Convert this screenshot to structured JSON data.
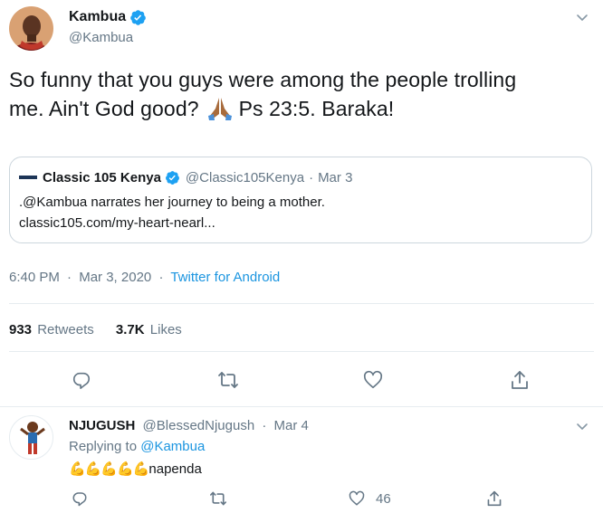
{
  "main_tweet": {
    "author": {
      "name": "Kambua",
      "handle": "@Kambua"
    },
    "text": "So funny that you guys were among the people trolling me. Ain't God good? 🙏🏾 Ps 23:5. Baraka!",
    "text_line1": "So funny that you guys were among the people trolling",
    "text_line2_a": "me. Ain't God good?",
    "text_line2_b": "Ps 23:5. Baraka!",
    "quote": {
      "name": "Classic 105 Kenya",
      "handle": "@Classic105Kenya",
      "dot": "·",
      "date": "Mar 3",
      "text_line1": ".@Kambua narrates her journey to being a mother.",
      "text_line2": "classic105.com/my-heart-nearl..."
    },
    "meta": {
      "time": "6:40 PM",
      "dot1": "·",
      "date": "Mar 3, 2020",
      "dot2": "·",
      "source": "Twitter for Android"
    },
    "stats": {
      "retweets_count": "933",
      "retweets_label": "Retweets",
      "likes_count": "3.7K",
      "likes_label": "Likes"
    }
  },
  "reply": {
    "name": "NJUGUSH",
    "handle": "@BlessedNjugush",
    "dot": "·",
    "date": "Mar 4",
    "replying_label": "Replying to",
    "replying_to": "@Kambua",
    "text_emoji": "💪💪💪💪💪",
    "text": "napenda",
    "like_count": "46"
  },
  "colors": {
    "accent": "#1da1f2",
    "link": "#1b95e0",
    "muted": "#657786",
    "border": "#e6ecf0"
  },
  "icons": [
    "verified-badge-icon",
    "chevron-down-icon",
    "reply-icon",
    "retweet-icon",
    "like-icon",
    "share-icon"
  ]
}
